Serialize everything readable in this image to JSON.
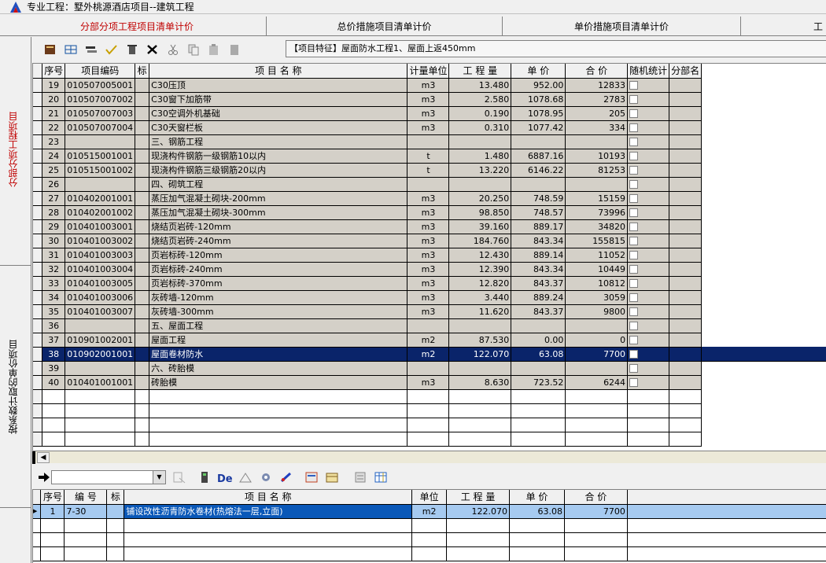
{
  "window": {
    "title": "专业工程：墅外桃源酒店项目--建筑工程"
  },
  "tabs": [
    "分部分项工程项目清单计价",
    "总价措施项目清单计价",
    "单价措施项目清单计价",
    "工"
  ],
  "side_tabs": [
    "分部分项工程项目",
    "按系数计取的单价项目"
  ],
  "feature_text": "【项目特征】屋面防水工程1、屋面上返450mm",
  "grid1": {
    "headers": [
      "序号",
      "项目编码",
      "标",
      "项    目    名    称",
      "计量单位",
      "工 程 量",
      "单  价",
      "合  价",
      "随机统计",
      "分部名"
    ],
    "rows": [
      [
        "19",
        "010507005001",
        "",
        "C30压顶",
        "m3",
        "13.480",
        "952.00",
        "12833"
      ],
      [
        "20",
        "010507007002",
        "",
        "C30窗下加筋带",
        "m3",
        "2.580",
        "1078.68",
        "2783"
      ],
      [
        "21",
        "010507007003",
        "",
        "C30空调外机基础",
        "m3",
        "0.190",
        "1078.95",
        "205"
      ],
      [
        "22",
        "010507007004",
        "",
        "C30天窗栏板",
        "m3",
        "0.310",
        "1077.42",
        "334"
      ],
      [
        "23",
        "",
        "",
        "三、钢筋工程",
        "",
        "",
        "",
        ""
      ],
      [
        "24",
        "010515001001",
        "",
        "现浇构件钢筋一级钢筋10以内",
        "t",
        "1.480",
        "6887.16",
        "10193"
      ],
      [
        "25",
        "010515001002",
        "",
        "现浇构件钢筋三级钢筋20以内",
        "t",
        "13.220",
        "6146.22",
        "81253"
      ],
      [
        "26",
        "",
        "",
        "四、砌筑工程",
        "",
        "",
        "",
        ""
      ],
      [
        "27",
        "010402001001",
        "",
        "蒸压加气混凝土砌块-200mm",
        "m3",
        "20.250",
        "748.59",
        "15159"
      ],
      [
        "28",
        "010402001002",
        "",
        "蒸压加气混凝土砌块-300mm",
        "m3",
        "98.850",
        "748.57",
        "73996"
      ],
      [
        "29",
        "010401003001",
        "",
        "烧结页岩砖-120mm",
        "m3",
        "39.160",
        "889.17",
        "34820"
      ],
      [
        "30",
        "010401003002",
        "",
        "烧结页岩砖-240mm",
        "m3",
        "184.760",
        "843.34",
        "155815"
      ],
      [
        "31",
        "010401003003",
        "",
        "页岩标砖-120mm",
        "m3",
        "12.430",
        "889.14",
        "11052"
      ],
      [
        "32",
        "010401003004",
        "",
        "页岩标砖-240mm",
        "m3",
        "12.390",
        "843.34",
        "10449"
      ],
      [
        "33",
        "010401003005",
        "",
        "页岩标砖-370mm",
        "m3",
        "12.820",
        "843.37",
        "10812"
      ],
      [
        "34",
        "010401003006",
        "",
        "灰砖墙-120mm",
        "m3",
        "3.440",
        "889.24",
        "3059"
      ],
      [
        "35",
        "010401003007",
        "",
        "灰砖墙-300mm",
        "m3",
        "11.620",
        "843.37",
        "9800"
      ],
      [
        "36",
        "",
        "",
        "五、屋面工程",
        "",
        "",
        "",
        ""
      ],
      [
        "37",
        "010901002001",
        "",
        "屋面工程",
        "m2",
        "87.530",
        "0.00",
        "0"
      ],
      [
        "38",
        "010902001001",
        "",
        "屋面卷材防水",
        "m2",
        "122.070",
        "63.08",
        "7700"
      ],
      [
        "39",
        "",
        "",
        "六、砖胎模",
        "",
        "",
        "",
        ""
      ],
      [
        "40",
        "010401001001",
        "",
        "砖胎模",
        "m3",
        "8.630",
        "723.52",
        "6244"
      ]
    ],
    "selected_row": "38"
  },
  "grid2": {
    "headers": [
      "序号",
      "编 号",
      "标",
      "项    目    名    称",
      "单位",
      "工 程 量",
      "单  价",
      "合  价"
    ],
    "rows": [
      [
        "1",
        "7-30",
        "",
        "铺设改性沥青防水卷材(热熔法一层,立面)",
        "m2",
        "122.070",
        "63.08",
        "7700"
      ]
    ]
  }
}
